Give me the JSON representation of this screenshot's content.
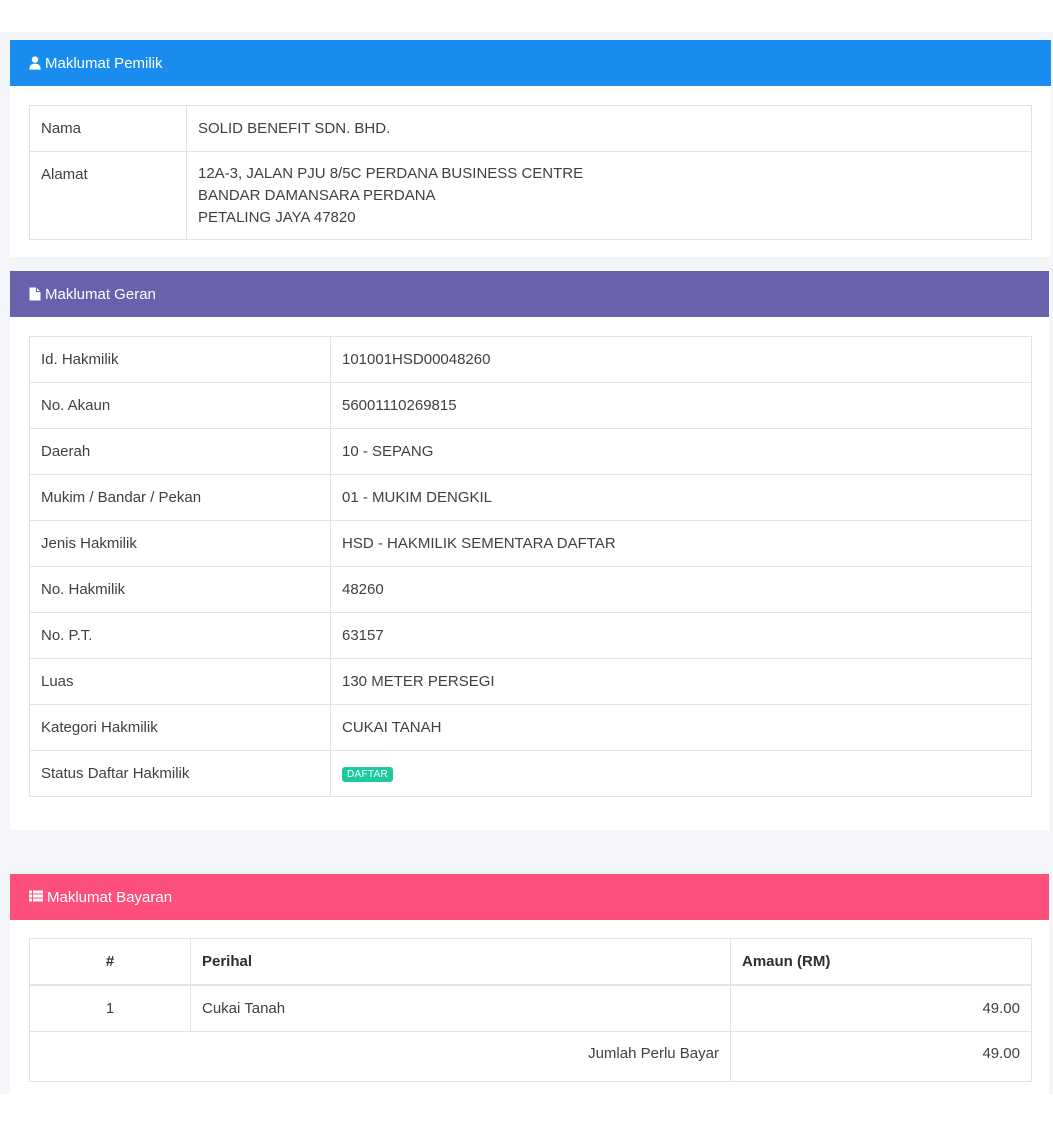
{
  "owner": {
    "title": "Maklumat Pemilik",
    "color": "#1a8cf0",
    "rows": {
      "nama_label": "Nama",
      "nama_value": "SOLID BENEFIT SDN. BHD.",
      "alamat_label": "Alamat",
      "alamat_line1": "12A-3, JALAN PJU 8/5C PERDANA BUSINESS CENTRE",
      "alamat_line2": "BANDAR DAMANSARA PERDANA",
      "alamat_line3": "PETALING JAYA 47820"
    }
  },
  "grant": {
    "title": "Maklumat Geran",
    "color": "#6762ab",
    "rows": [
      {
        "label": "Id. Hakmilik",
        "value": "101001HSD00048260"
      },
      {
        "label": "No. Akaun",
        "value": "56001110269815"
      },
      {
        "label": "Daerah",
        "value": "10 - SEPANG"
      },
      {
        "label": "Mukim / Bandar / Pekan",
        "value": "01 - MUKIM DENGKIL"
      },
      {
        "label": "Jenis Hakmilik",
        "value": "HSD - HAKMILIK SEMENTARA DAFTAR"
      },
      {
        "label": "No. Hakmilik",
        "value": "48260"
      },
      {
        "label": "No. P.T.",
        "value": "63157"
      },
      {
        "label": "Luas",
        "value": "130 METER PERSEGI"
      },
      {
        "label": "Kategori Hakmilik",
        "value": "CUKAI TANAH"
      }
    ],
    "status_label": "Status Daftar Hakmilik",
    "status_badge": "DAFTAR",
    "badge_color": "#1dc9a0"
  },
  "payment": {
    "title": "Maklumat Bayaran",
    "color": "#fd4f7c",
    "headers": {
      "no": "#",
      "perihal": "Perihal",
      "amaun": "Amaun (RM)"
    },
    "items": [
      {
        "no": "1",
        "perihal": "Cukai Tanah",
        "amaun": "49.00"
      }
    ],
    "total_label": "Jumlah Perlu Bayar",
    "total_value": "49.00"
  }
}
